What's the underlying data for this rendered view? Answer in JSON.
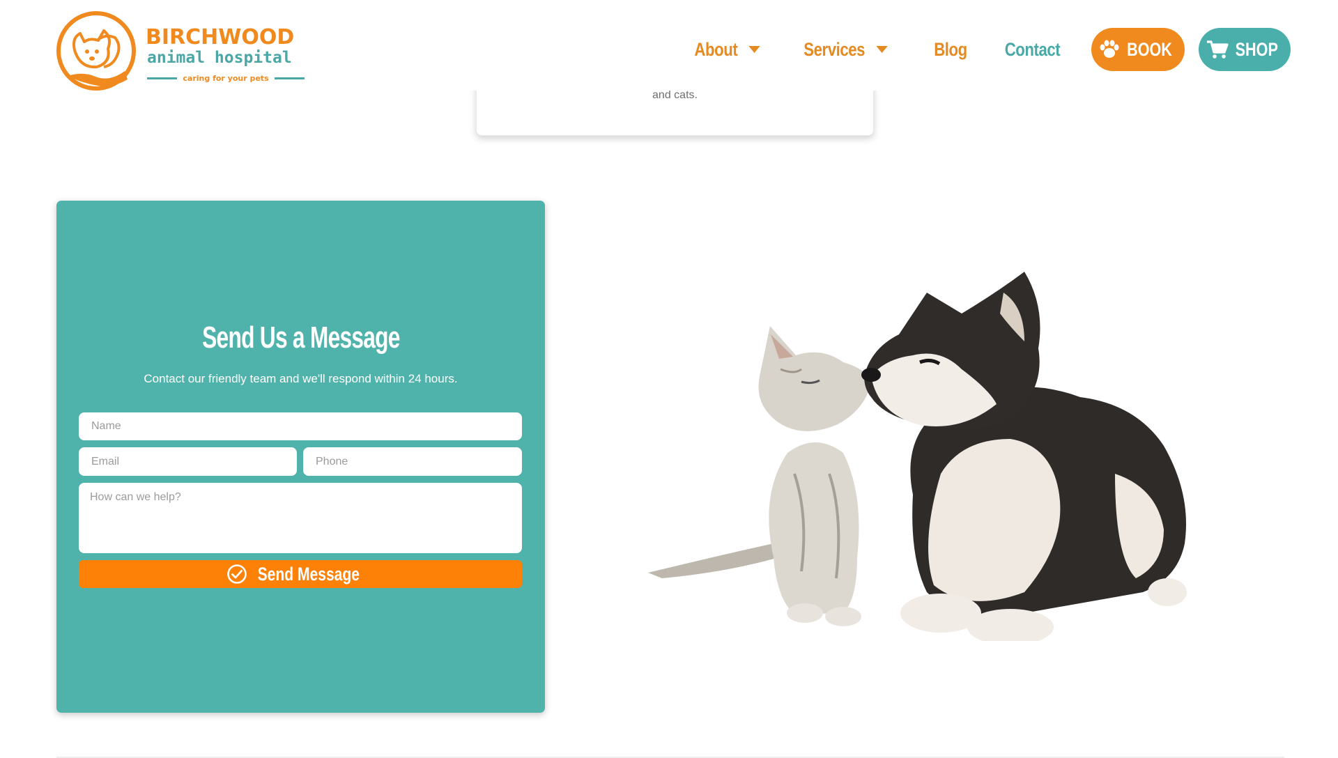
{
  "brand": {
    "name": "BIRCHWOOD",
    "subtitle": "animal hospital",
    "tagline": "caring for your pets",
    "colors": {
      "orange": "#f08a1f",
      "teal": "#4aa7a6"
    }
  },
  "nav": {
    "about": "About",
    "services": "Services",
    "blog": "Blog",
    "contact": "Contact",
    "book": "BOOK",
    "shop": "SHOP"
  },
  "prev_card": {
    "text": "and cats."
  },
  "contact_form": {
    "title": "Send Us a Message",
    "subtitle": "Contact our friendly team and we'll respond within 24 hours.",
    "name_placeholder": "Name",
    "email_placeholder": "Email",
    "phone_placeholder": "Phone",
    "message_placeholder": "How can we help?",
    "submit_label": "Send Message",
    "colors": {
      "card": "#50b3ab",
      "button": "#fd8107"
    }
  },
  "image": {
    "subject": "kitten and husky puppy"
  }
}
